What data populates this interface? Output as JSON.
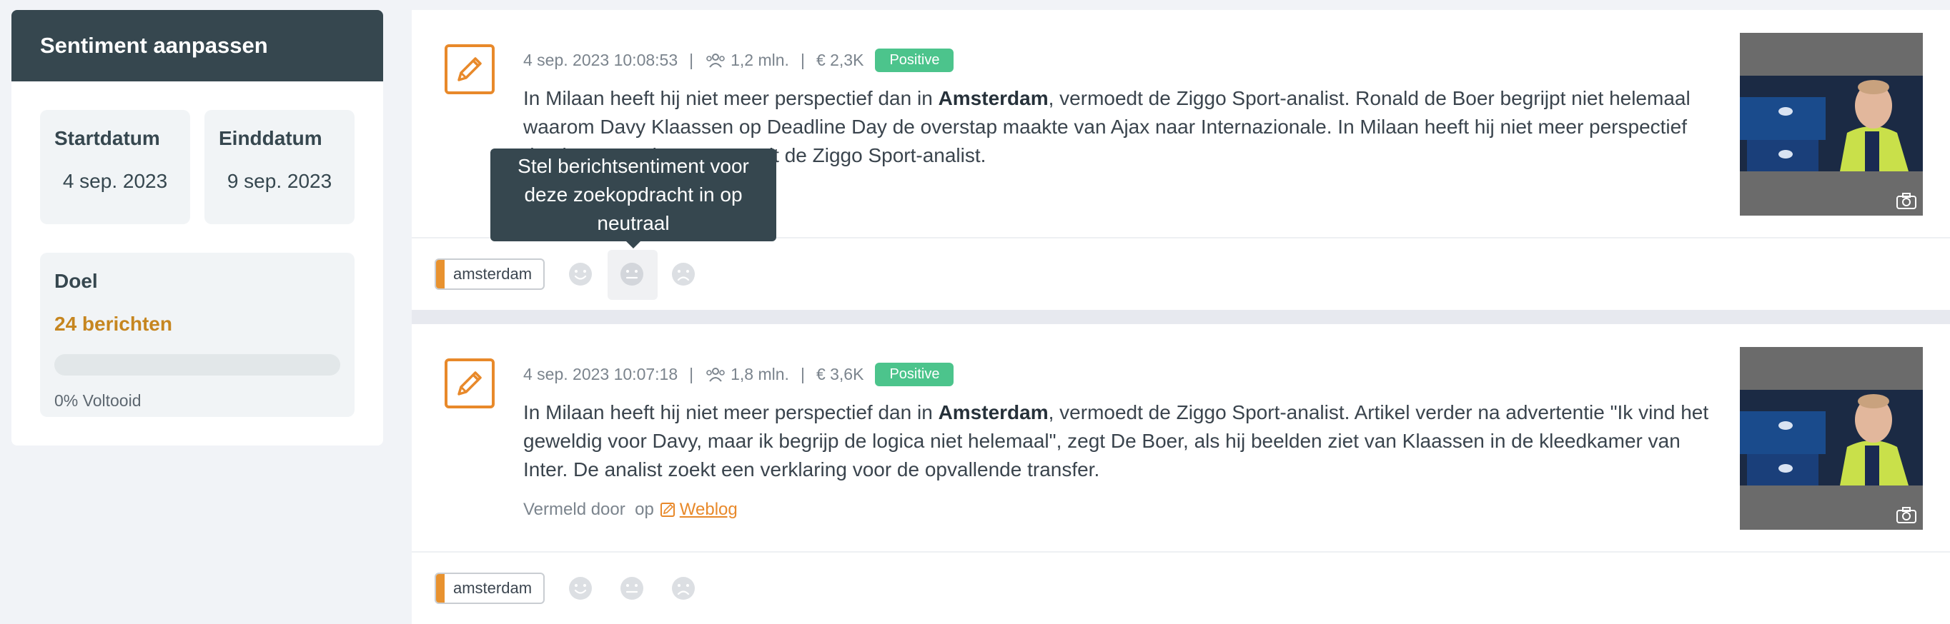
{
  "sidebar": {
    "title": "Sentiment aanpassen",
    "start": {
      "label": "Startdatum",
      "value": "4 sep. 2023"
    },
    "end": {
      "label": "Einddatum",
      "value": "9 sep. 2023"
    },
    "goal": {
      "label": "Doel",
      "count": "24 berichten",
      "progress_fraction": 0,
      "percent_text": "0% Voltooid"
    }
  },
  "tooltip": "Stel berichtsentiment voor deze zoekopdracht in op neutraal",
  "posts": [
    {
      "timestamp": "4 sep. 2023 10:08:53",
      "reach": "1,2 mln.",
      "value": "€ 2,3K",
      "sentiment": "Positive",
      "text_before": "In Milaan heeft hij niet meer perspectief dan in ",
      "text_keyword": "Amsterdam",
      "text_after": ", vermoedt de Ziggo Sport-analist. Ronald de Boer begrijpt niet helemaal waarom Davy Klaassen op Deadline Day de overstap maakte van Ajax naar Internazionale. In Milaan heeft hij niet meer perspectief dan in Amsterdam, vermoedt de Ziggo Sport-analist.",
      "mention_prefix": "Vermeld door",
      "mention_on": "op",
      "source": "Weblog",
      "tag": "amsterdam"
    },
    {
      "timestamp": "4 sep. 2023 10:07:18",
      "reach": "1,8 mln.",
      "value": "€ 3,6K",
      "sentiment": "Positive",
      "text_before": "In Milaan heeft hij niet meer perspectief dan in ",
      "text_keyword": "Amsterdam",
      "text_after": ", vermoedt de Ziggo Sport-analist. Artikel verder na advertentie \"Ik vind het geweldig voor Davy, maar ik begrijp de logica niet helemaal\", zegt De Boer, als hij beelden ziet van Klaassen in de kleedkamer van Inter. De analist zoekt een verklaring voor de opvallende transfer.",
      "mention_prefix": "Vermeld door",
      "mention_on": "op",
      "source": "Weblog",
      "tag": "amsterdam"
    }
  ],
  "colors": {
    "accent": "#e8892a",
    "header": "#36474f",
    "badge": "#4cc48c"
  }
}
